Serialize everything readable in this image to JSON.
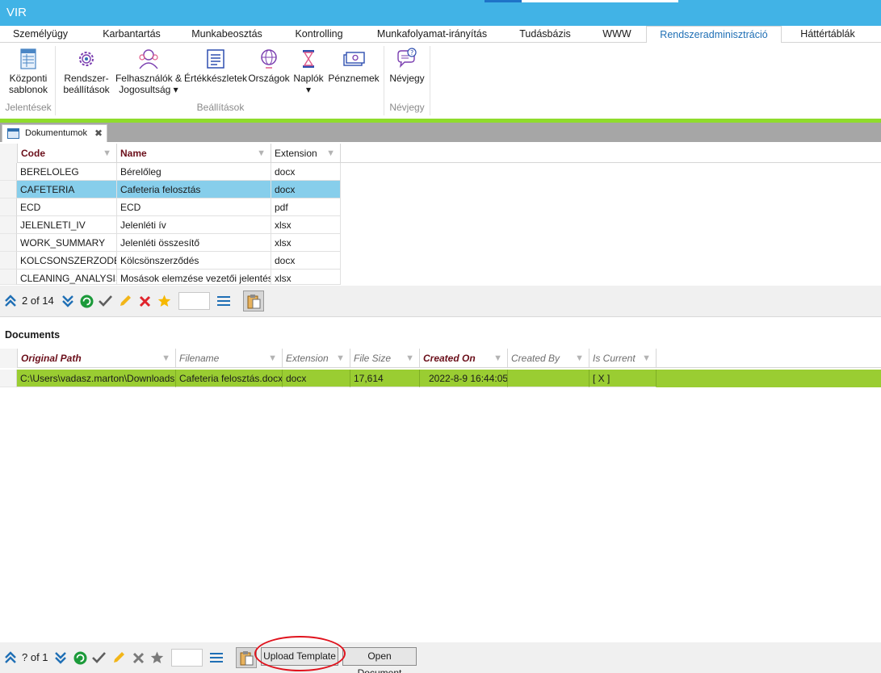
{
  "app": {
    "title": "VIR"
  },
  "menu": {
    "tabs": [
      {
        "label": "Személyügy"
      },
      {
        "label": "Karbantartás"
      },
      {
        "label": "Munkabeosztás"
      },
      {
        "label": "Kontrolling"
      },
      {
        "label": "Munkafolyamat-irányítás"
      },
      {
        "label": "Tudásbázis"
      },
      {
        "label": "WWW"
      },
      {
        "label": "Rendszeradminisztráció"
      },
      {
        "label": "Háttértáblák"
      }
    ],
    "active": "Rendszeradminisztráció"
  },
  "ribbon": {
    "buttons": [
      {
        "line1": "Központi",
        "line2": "sablonok",
        "icon": "document-grid-icon"
      },
      {
        "line1": "Rendszer-",
        "line2": "beállítások",
        "icon": "gear-icon"
      },
      {
        "line1": "Felhasználók &",
        "line2": "Jogosultság ▾",
        "icon": "users-icon"
      },
      {
        "line1": "Értékkészletek",
        "line2": "",
        "icon": "list-icon"
      },
      {
        "line1": "Országok",
        "line2": "",
        "icon": "globe-icon"
      },
      {
        "line1": "Naplók",
        "line2": "▾",
        "icon": "hourglass-log-icon"
      },
      {
        "line1": "Pénznemek",
        "line2": "",
        "icon": "banknotes-icon"
      },
      {
        "line1": "Névjegy",
        "line2": "",
        "icon": "about-bubble-icon"
      }
    ],
    "groups": [
      {
        "label": "Jelentések"
      },
      {
        "label": "Beállítások"
      },
      {
        "label": "Névjegy"
      }
    ]
  },
  "doc_tab": {
    "label": "Dokumentumok",
    "close": "✖"
  },
  "templates_grid": {
    "columns": [
      {
        "label": "Code"
      },
      {
        "label": "Name"
      },
      {
        "label": "Extension"
      }
    ],
    "rows": [
      {
        "code": "BERELOLEG",
        "name": "Bérelőleg",
        "ext": "docx"
      },
      {
        "code": "CAFETERIA",
        "name": "Cafeteria felosztás",
        "ext": "docx"
      },
      {
        "code": "ECD",
        "name": "ECD",
        "ext": "pdf"
      },
      {
        "code": "JELENLETI_IV",
        "name": "Jelenléti ív",
        "ext": "xlsx"
      },
      {
        "code": "WORK_SUMMARY",
        "name": "Jelenléti összesítő",
        "ext": "xlsx"
      },
      {
        "code": "KOLCSONSZERZODES",
        "name": "Kölcsönszerződés",
        "ext": "docx"
      },
      {
        "code": "CLEANING_ANALYSIS",
        "name": "Mosások elemzése vezetői jelentés",
        "ext": "xlsx"
      }
    ],
    "selected_row": 1,
    "selected_color": "#87ceeb"
  },
  "navigator_top": {
    "position": "2 of 14"
  },
  "documents": {
    "title": "Documents",
    "columns": [
      {
        "label": "Original Path"
      },
      {
        "label": "Filename"
      },
      {
        "label": "Extension"
      },
      {
        "label": "File Size"
      },
      {
        "label": "Created On"
      },
      {
        "label": "Created By"
      },
      {
        "label": "Is Current"
      }
    ],
    "rows": [
      {
        "original_path": "C:\\Users\\vadasz.marton\\Downloads",
        "filename": "Cafeteria felosztás.docx",
        "extension": "docx",
        "file_size": "17,614",
        "created_on": "2022-8-9 16:44:05",
        "created_by": "",
        "is_current": "[ X ]"
      }
    ],
    "row_color": "#9acd32"
  },
  "navigator_bottom": {
    "position": "? of 1",
    "upload_label": "Upload Template",
    "open_label": "Open Document"
  },
  "colors": {
    "titlebar": "#41b3e6",
    "accent_line": "#8fdc2c",
    "header_text": "#6b0f1a",
    "annotation": "#e0131d"
  }
}
